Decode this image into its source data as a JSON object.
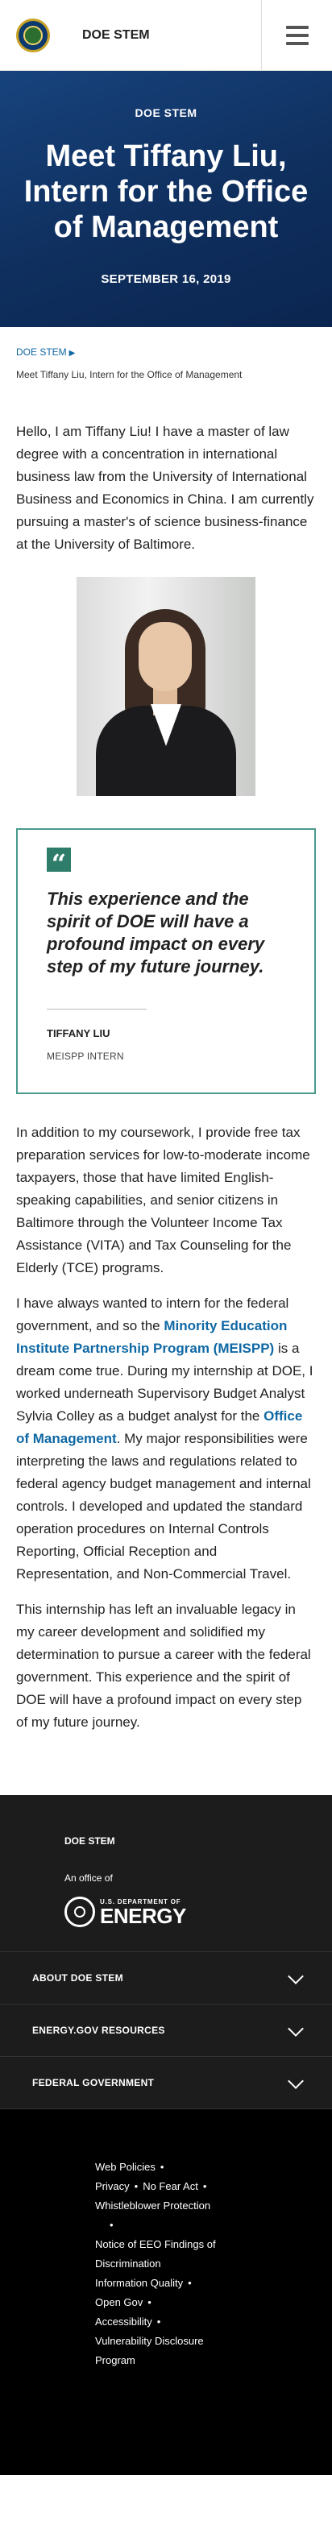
{
  "header": {
    "site_name": "DOE STEM",
    "menu_icon": "hamburger-menu-icon"
  },
  "hero": {
    "kicker": "DOE STEM",
    "title": "Meet Tiffany Liu, Intern for the Office of Management",
    "date": "SEPTEMBER 16, 2019",
    "bg_color": "#123a6e"
  },
  "breadcrumb": {
    "link": "DOE STEM",
    "current": "Meet Tiffany Liu, Intern for the Office of Management"
  },
  "article": {
    "intro": "Hello, I am Tiffany Liu! I have a master of law degree with a concentration in international business law from the University of International Business and Economics in China. I am currently pursuing a master's of science business-finance at the University of Baltimore.",
    "quote": {
      "text": "This experience and the spirit of DOE will have a profound impact on every step of my future journey.",
      "name": "TIFFANY LIU",
      "role": "MEISPP INTERN"
    },
    "p2": "In addition to my coursework, I provide free tax preparation services for low-to-moderate income taxpayers, those that have limited English-speaking capabilities, and senior citizens in Baltimore through the Volunteer Income Tax Assistance (VITA) and Tax Counseling for the Elderly (TCE) programs.",
    "p3_a": "I have always wanted to intern for the federal government, and so the ",
    "p3_link1": "Minority Education Institute Partnership Program (MEISPP)",
    "p3_b": " is a dream come true. During my internship at DOE, I worked underneath Supervisory Budget Analyst Sylvia Colley as a budget analyst for the ",
    "p3_link2": "Office of Management",
    "p3_c": ". My major responsibilities were interpreting the laws and regulations related to federal agency budget management and internal controls. I developed and updated the standard operation procedures on Internal Controls Reporting, Official Reception and Representation, and Non-Commercial Travel.",
    "p4": "This internship has left an invaluable legacy in my career development and solidified my determination to pursue a career with the federal government. This experience and the spirit of DOE will have a profound impact on every step of my future journey.",
    "link_color": "#0f68a4"
  },
  "footer": {
    "title": "DOE STEM",
    "office_of": "An office of",
    "logo_small": "U.S. DEPARTMENT OF",
    "logo_big": "ENERGY",
    "sections": [
      "ABOUT DOE STEM",
      "ENERGY.GOV RESOURCES",
      "FEDERAL GOVERNMENT"
    ],
    "links": {
      "web_policies": "Web Policies",
      "privacy": "Privacy",
      "no_fear": "No Fear Act",
      "whistleblower": "Whistleblower Protection",
      "eeo": "Notice of EEO Findings of Discrimination",
      "info_quality": "Information Quality",
      "open_gov": "Open Gov",
      "accessibility": "Accessibility",
      "vdp": "Vulnerability Disclosure Program"
    },
    "bg_color": "#1c1c1c"
  }
}
